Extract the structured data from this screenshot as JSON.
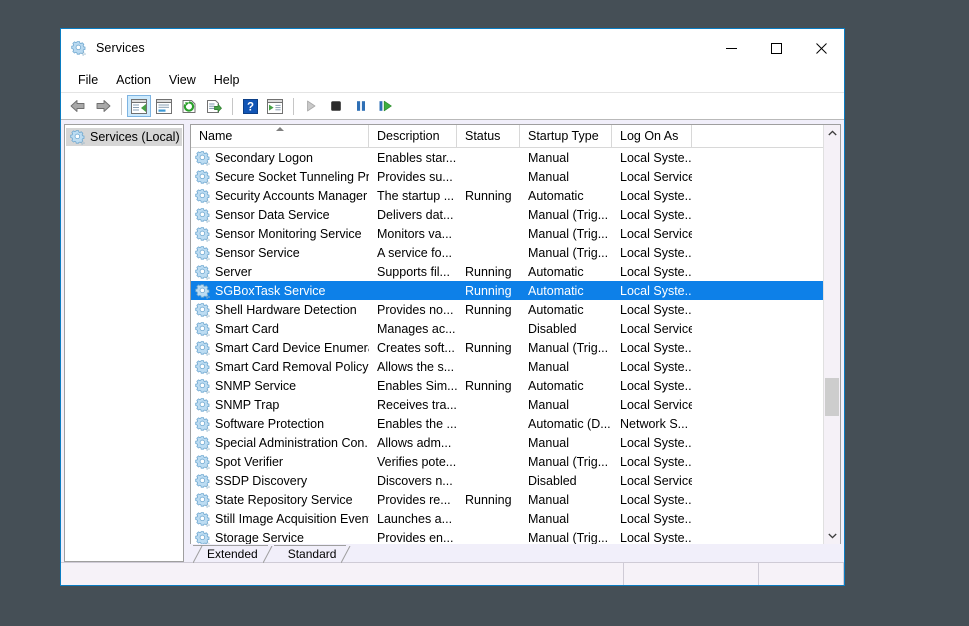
{
  "window": {
    "title": "Services",
    "icon": "services-gear-icon",
    "accent_color": "#0d80e8",
    "border_color": "#0a7cc1",
    "desktop_background": "#454f56",
    "controls": {
      "minimize": "minimize",
      "maximize": "maximize",
      "close": "close"
    }
  },
  "menu": {
    "items": [
      {
        "label": "File"
      },
      {
        "label": "Action"
      },
      {
        "label": "View"
      },
      {
        "label": "Help"
      }
    ]
  },
  "toolbar": {
    "buttons": [
      {
        "name": "back-button",
        "icon": "back-arrow-icon",
        "enabled": true
      },
      {
        "name": "forward-button",
        "icon": "forward-arrow-icon",
        "enabled": true
      },
      {
        "name": "show-hide-console-tree-button",
        "icon": "console-tree-icon",
        "active": true
      },
      {
        "name": "properties-button",
        "icon": "properties-icon",
        "active": false
      },
      {
        "name": "refresh-button",
        "icon": "refresh-icon",
        "active": false
      },
      {
        "name": "export-list-button",
        "icon": "export-list-icon",
        "active": false
      },
      {
        "name": "help-button",
        "icon": "help-question-icon",
        "active": false
      },
      {
        "name": "show-action-pane-button",
        "icon": "action-pane-icon",
        "active": false
      },
      {
        "name": "start-service-button",
        "icon": "play-icon",
        "enabled": false
      },
      {
        "name": "stop-service-button",
        "icon": "stop-icon",
        "enabled": true
      },
      {
        "name": "pause-service-button",
        "icon": "pause-icon",
        "enabled": true
      },
      {
        "name": "restart-service-button",
        "icon": "restart-icon",
        "enabled": true
      }
    ]
  },
  "tree": {
    "items": [
      {
        "label": "Services (Local)",
        "icon": "services-gear-icon",
        "selected": true
      }
    ]
  },
  "list": {
    "columns": [
      {
        "key": "name",
        "label": "Name",
        "sorted": true,
        "sort_direction": "ascending"
      },
      {
        "key": "description",
        "label": "Description"
      },
      {
        "key": "status",
        "label": "Status"
      },
      {
        "key": "startup",
        "label": "Startup Type"
      },
      {
        "key": "logon",
        "label": "Log On As"
      }
    ],
    "rows": [
      {
        "name": "Secondary Logon",
        "description": "Enables star...",
        "status": "",
        "startup": "Manual",
        "logon": "Local Syste...",
        "selected": false
      },
      {
        "name": "Secure Socket Tunneling Pr...",
        "description": "Provides su...",
        "status": "",
        "startup": "Manual",
        "logon": "Local Service",
        "selected": false
      },
      {
        "name": "Security Accounts Manager",
        "description": "The startup ...",
        "status": "Running",
        "startup": "Automatic",
        "logon": "Local Syste...",
        "selected": false
      },
      {
        "name": "Sensor Data Service",
        "description": "Delivers dat...",
        "status": "",
        "startup": "Manual (Trig...",
        "logon": "Local Syste...",
        "selected": false
      },
      {
        "name": "Sensor Monitoring Service",
        "description": "Monitors va...",
        "status": "",
        "startup": "Manual (Trig...",
        "logon": "Local Service",
        "selected": false
      },
      {
        "name": "Sensor Service",
        "description": "A service fo...",
        "status": "",
        "startup": "Manual (Trig...",
        "logon": "Local Syste...",
        "selected": false
      },
      {
        "name": "Server",
        "description": "Supports fil...",
        "status": "Running",
        "startup": "Automatic",
        "logon": "Local Syste...",
        "selected": false
      },
      {
        "name": "SGBoxTask Service",
        "description": "",
        "status": "Running",
        "startup": "Automatic",
        "logon": "Local Syste...",
        "selected": true
      },
      {
        "name": "Shell Hardware Detection",
        "description": "Provides no...",
        "status": "Running",
        "startup": "Automatic",
        "logon": "Local Syste...",
        "selected": false
      },
      {
        "name": "Smart Card",
        "description": "Manages ac...",
        "status": "",
        "startup": "Disabled",
        "logon": "Local Service",
        "selected": false
      },
      {
        "name": "Smart Card Device Enumera...",
        "description": "Creates soft...",
        "status": "Running",
        "startup": "Manual (Trig...",
        "logon": "Local Syste...",
        "selected": false
      },
      {
        "name": "Smart Card Removal Policy",
        "description": "Allows the s...",
        "status": "",
        "startup": "Manual",
        "logon": "Local Syste...",
        "selected": false
      },
      {
        "name": "SNMP Service",
        "description": "Enables Sim...",
        "status": "Running",
        "startup": "Automatic",
        "logon": "Local Syste...",
        "selected": false
      },
      {
        "name": "SNMP Trap",
        "description": "Receives tra...",
        "status": "",
        "startup": "Manual",
        "logon": "Local Service",
        "selected": false
      },
      {
        "name": "Software Protection",
        "description": "Enables the ...",
        "status": "",
        "startup": "Automatic (D...",
        "logon": "Network S...",
        "selected": false
      },
      {
        "name": "Special Administration Con...",
        "description": "Allows adm...",
        "status": "",
        "startup": "Manual",
        "logon": "Local Syste...",
        "selected": false
      },
      {
        "name": "Spot Verifier",
        "description": "Verifies pote...",
        "status": "",
        "startup": "Manual (Trig...",
        "logon": "Local Syste...",
        "selected": false
      },
      {
        "name": "SSDP Discovery",
        "description": "Discovers n...",
        "status": "",
        "startup": "Disabled",
        "logon": "Local Service",
        "selected": false
      },
      {
        "name": "State Repository Service",
        "description": "Provides re...",
        "status": "Running",
        "startup": "Manual",
        "logon": "Local Syste...",
        "selected": false
      },
      {
        "name": "Still Image Acquisition Events",
        "description": "Launches a...",
        "status": "",
        "startup": "Manual",
        "logon": "Local Syste...",
        "selected": false
      },
      {
        "name": "Storage Service",
        "description": "Provides en...",
        "status": "",
        "startup": "Manual (Trig...",
        "logon": "Local Syste...",
        "selected": false
      }
    ]
  },
  "tabs": [
    {
      "label": "Extended",
      "active": false
    },
    {
      "label": "Standard",
      "active": true
    }
  ],
  "statusbar": {
    "main": "",
    "segment_a": "",
    "segment_b": ""
  }
}
